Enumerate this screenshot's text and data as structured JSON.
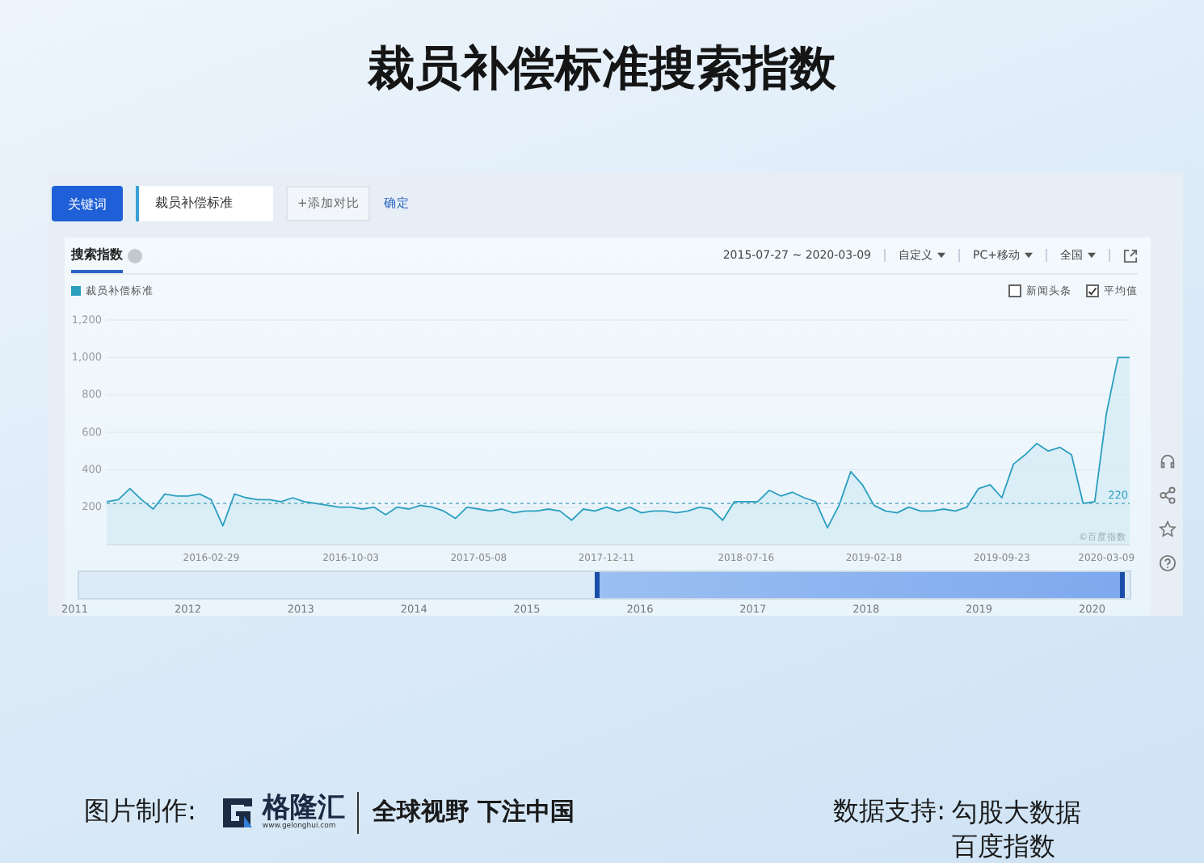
{
  "title": "裁员补偿标准搜索指数",
  "search_bar": {
    "keyword_tab": "关键词",
    "keyword_value": "裁员补偿标准",
    "add_compare_button": "+添加对比",
    "confirm_link": "确定"
  },
  "card": {
    "tab": "搜索指数",
    "date_range": "2015-07-27 ~ 2020-03-09",
    "dropdowns": [
      "自定义",
      "PC+移动",
      "全国"
    ],
    "options": [
      {
        "label": "新闻头条",
        "checked": false
      },
      {
        "label": "平均值",
        "checked": true
      }
    ],
    "chart_data": {
      "type": "area",
      "grid": true,
      "ylim": [
        0,
        1200
      ],
      "yticks": [
        {
          "value": 200,
          "label": "200"
        },
        {
          "value": 400,
          "label": "400"
        },
        {
          "value": 600,
          "label": "600"
        },
        {
          "value": 800,
          "label": "800"
        },
        {
          "value": 1000,
          "label": "1,000"
        },
        {
          "value": 1200,
          "label": "1,200"
        }
      ],
      "categories": [
        null,
        null,
        null,
        null,
        null,
        null,
        null,
        null,
        null,
        "2016-02-29",
        null,
        null,
        null,
        null,
        null,
        null,
        null,
        null,
        null,
        null,
        null,
        "2016-10-03",
        null,
        null,
        null,
        null,
        null,
        null,
        null,
        null,
        null,
        null,
        "2017-05-08",
        null,
        null,
        null,
        null,
        null,
        null,
        null,
        null,
        null,
        null,
        "2017-12-11",
        null,
        null,
        null,
        null,
        null,
        null,
        null,
        null,
        null,
        null,
        null,
        "2018-07-16",
        null,
        null,
        null,
        null,
        null,
        null,
        null,
        null,
        null,
        null,
        "2019-02-18",
        null,
        null,
        null,
        null,
        null,
        null,
        null,
        null,
        null,
        null,
        "2019-09-23",
        null,
        null,
        null,
        null,
        null,
        null,
        null,
        null,
        "2020-03-09",
        null,
        null
      ],
      "series": [
        {
          "name": "裁员补偿标准",
          "color": "#2a9fc0",
          "values": [
            230,
            240,
            300,
            240,
            190,
            270,
            260,
            260,
            270,
            240,
            100,
            270,
            250,
            240,
            240,
            230,
            250,
            230,
            220,
            210,
            200,
            200,
            190,
            200,
            160,
            200,
            190,
            210,
            200,
            180,
            140,
            200,
            190,
            180,
            190,
            170,
            180,
            180,
            190,
            180,
            130,
            190,
            180,
            200,
            180,
            200,
            170,
            180,
            180,
            170,
            180,
            200,
            190,
            130,
            230,
            230,
            230,
            290,
            260,
            280,
            250,
            230,
            90,
            210,
            390,
            320,
            210,
            180,
            170,
            200,
            180,
            180,
            190,
            180,
            200,
            300,
            320,
            250,
            430,
            480,
            540,
            500,
            520,
            480,
            220,
            230,
            700,
            1000,
            1000
          ]
        }
      ],
      "ref_lines": [
        {
          "axis": "y",
          "value": 220,
          "label": "220"
        }
      ]
    },
    "source": "©百度指数",
    "navigator_years": [
      "2011",
      "2012",
      "2013",
      "2014",
      "2015",
      "2016",
      "2017",
      "2018",
      "2019",
      "2020"
    ]
  },
  "footer": {
    "made_by_label": "图片制作:",
    "logo_name": "格隆汇",
    "logo_url": "www.gelonghui.com",
    "slogan": "全球视野 下注中国",
    "data_label": "数据支持:",
    "data_sources": [
      "勾股大数据",
      "百度指数"
    ]
  }
}
